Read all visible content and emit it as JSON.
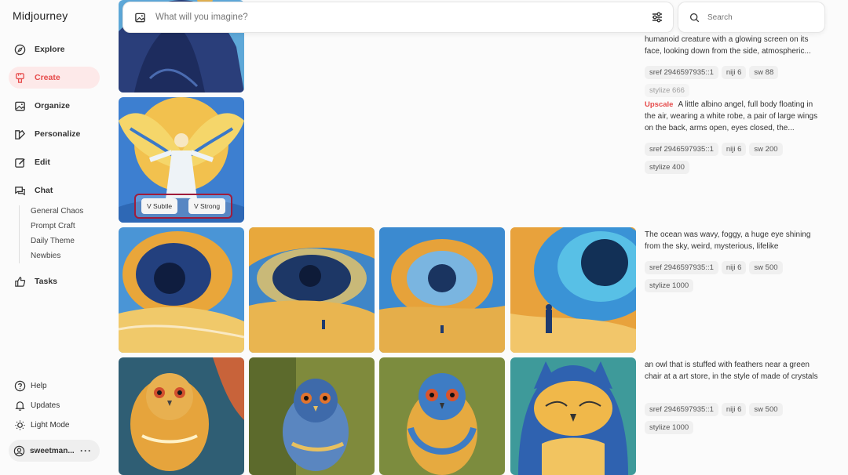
{
  "app": {
    "title": "Midjourney"
  },
  "sidebar": {
    "items": [
      {
        "label": "Explore",
        "icon": "compass-icon"
      },
      {
        "label": "Create",
        "icon": "brush-icon",
        "active": true
      },
      {
        "label": "Organize",
        "icon": "image-icon"
      },
      {
        "label": "Personalize",
        "icon": "palette-icon"
      },
      {
        "label": "Edit",
        "icon": "edit-icon"
      },
      {
        "label": "Chat",
        "icon": "chat-icon"
      },
      {
        "label": "Tasks",
        "icon": "thumbs-up-icon"
      }
    ],
    "chat_rooms": [
      "General Chaos",
      "Prompt Craft",
      "Daily Theme",
      "Newbies"
    ],
    "bottom": [
      {
        "label": "Help",
        "icon": "help-icon"
      },
      {
        "label": "Updates",
        "icon": "bell-icon"
      },
      {
        "label": "Light Mode",
        "icon": "sun-icon"
      }
    ],
    "user": {
      "name": "sweetman...",
      "more": "···"
    }
  },
  "prompt_bar": {
    "placeholder": "What will you imagine?"
  },
  "search": {
    "placeholder": "Search"
  },
  "accent_color": "#e64b4b",
  "jobs": [
    {
      "prompt": "humanoid creature with a glowing screen on its face, looking down from the side, atmospheric...",
      "chips": [
        "sref 2946597935::1",
        "niji 6",
        "sw 88",
        "stylize 666"
      ]
    },
    {
      "badge": "Upscale",
      "prompt": "A little albino angel, full body floating in the air, wearing a white robe, a pair of large wings on the back, arms open, eyes closed, the...",
      "chips": [
        "sref 2946597935::1",
        "niji 6",
        "sw 200",
        "stylize 400"
      ],
      "vary_buttons": [
        "V Subtle",
        "V Strong"
      ]
    },
    {
      "prompt": "The ocean was wavy, foggy, a huge eye shining from the sky, weird, mysterious, lifelike",
      "chips": [
        "sref 2946597935::1",
        "niji 6",
        "sw 500",
        "stylize 1000"
      ]
    },
    {
      "prompt": "an owl that is stuffed with feathers near a green chair at a art store, in the style of made of crystals",
      "chips": [
        "sref 2946597935::1",
        "niji 6",
        "sw 500",
        "stylize 1000"
      ]
    }
  ]
}
